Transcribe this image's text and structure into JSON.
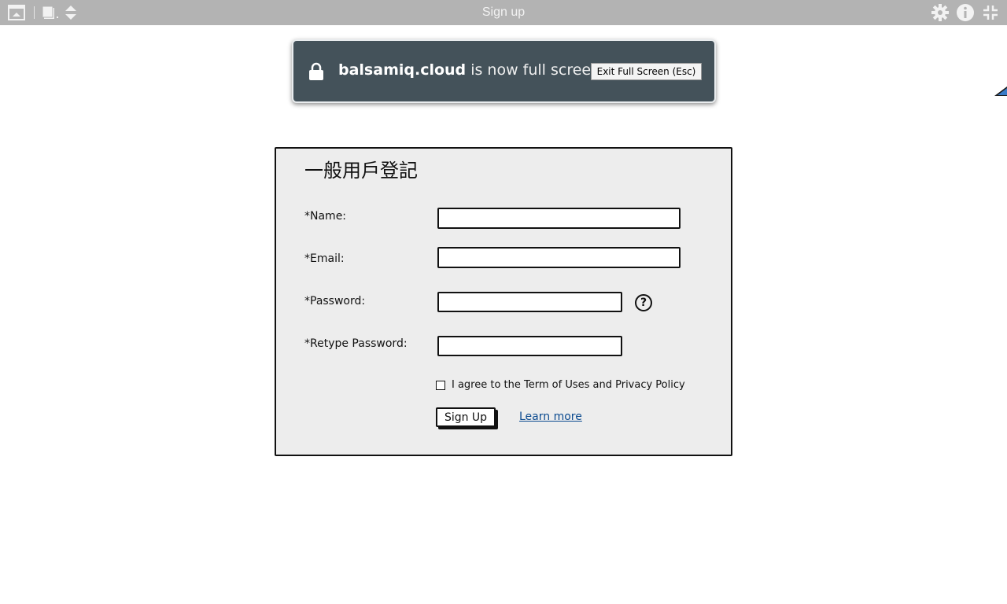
{
  "topbar": {
    "title": "Sign up",
    "icons": [
      "presentation-icon",
      "pages-icon",
      "sort-arrows-icon",
      "gear-icon",
      "info-icon",
      "exit-fullscreen-icon"
    ],
    "bg_color": "#b3b3b3"
  },
  "fullscreen_notice": {
    "domain": "balsamiq.cloud",
    "message": "is now full screen",
    "exit_label": "Exit Full Screen (Esc)",
    "bg_color": "#44525a"
  },
  "form": {
    "title": "一般用戶登記",
    "fields": [
      {
        "label": "*Name:",
        "value": ""
      },
      {
        "label": "*Email:",
        "value": ""
      },
      {
        "label": "*Password:",
        "value": ""
      },
      {
        "label": "*Retype Password:",
        "value": ""
      }
    ],
    "help_symbol": "?",
    "agree_text": "I agree to the Term of Uses and Privacy Policy",
    "signup_label": "Sign Up",
    "learn_more_label": "Learn more",
    "link_color": "#0b4a8f"
  }
}
